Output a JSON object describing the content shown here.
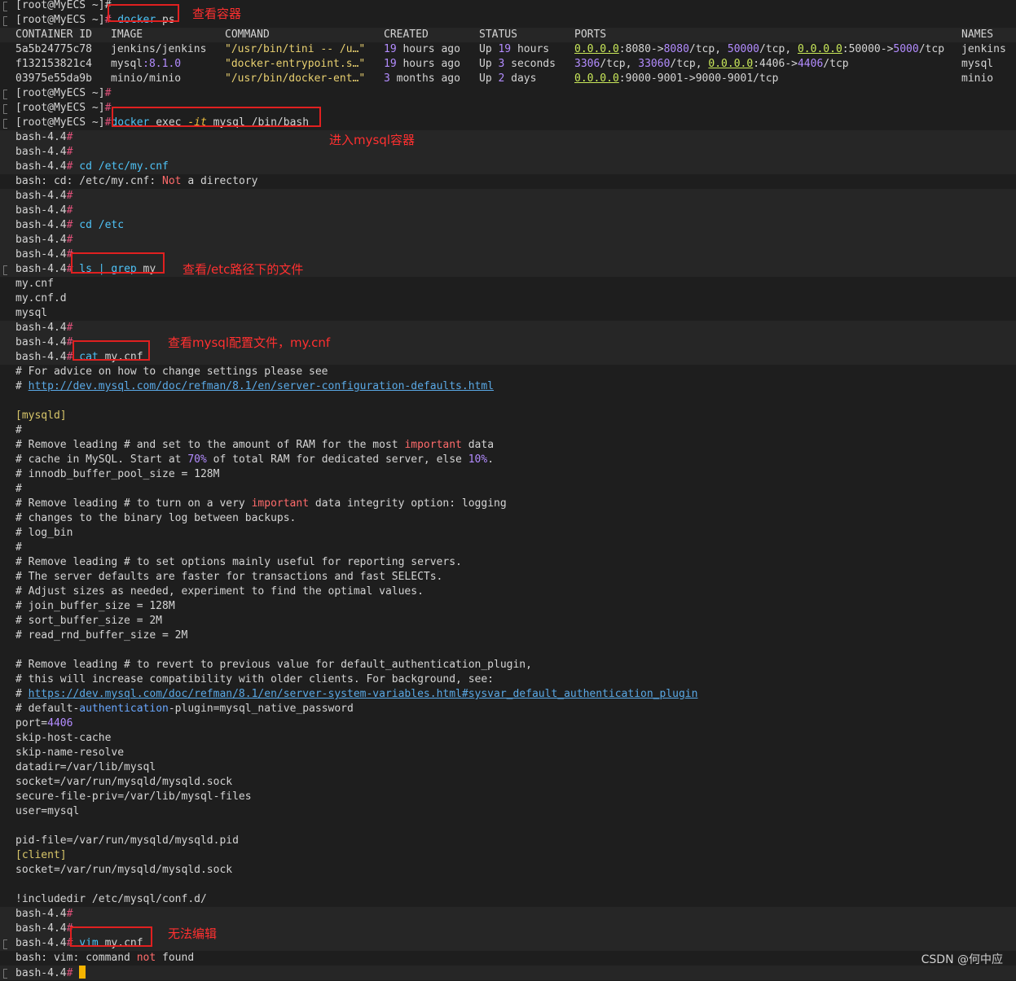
{
  "prompt_user": "[root@MyECS ~]",
  "bash_prompt": "bash-4.4",
  "hash": "#",
  "top_partial": "[root@MyECS ~]#",
  "cmd_docker_ps": {
    "cmd": "docker",
    "arg": "ps"
  },
  "docker_ps": {
    "headers": [
      "CONTAINER ID",
      "IMAGE",
      "COMMAND",
      "CREATED",
      "STATUS",
      "PORTS",
      "NAMES"
    ],
    "rows": [
      {
        "id": "5a5b24775c78",
        "image": "jenkins/jenkins",
        "image_tag": "",
        "command": "\"/usr/bin/tini -- /u…\"",
        "created_num": "19",
        "created_rest": " hours ago",
        "status_pre": "Up ",
        "status_num": "19",
        "status_rest": " hours",
        "ports": [
          [
            "g",
            "0.0.0.0"
          ],
          [
            "t",
            ":8080->"
          ],
          [
            "p",
            "8080"
          ],
          [
            "t",
            "/tcp, "
          ],
          [
            "p",
            "50000"
          ],
          [
            "t",
            "/tcp, "
          ],
          [
            "g",
            "0.0.0.0"
          ],
          [
            "t",
            ":50000->"
          ],
          [
            "p",
            "5000"
          ],
          [
            "t",
            "/tcp"
          ]
        ],
        "name": "jenkins"
      },
      {
        "id": "f132153821c4",
        "image": "mysql",
        "image_tag": ":8.1.0",
        "command": "\"docker-entrypoint.s…\"",
        "created_num": "19",
        "created_rest": " hours ago",
        "status_pre": "Up ",
        "status_num": "3",
        "status_rest": " seconds",
        "ports": [
          [
            "p",
            "3306"
          ],
          [
            "t",
            "/tcp, "
          ],
          [
            "p",
            "33060"
          ],
          [
            "t",
            "/tcp, "
          ],
          [
            "g",
            "0.0.0.0"
          ],
          [
            "t",
            ":4406->"
          ],
          [
            "p",
            "4406"
          ],
          [
            "t",
            "/tcp"
          ]
        ],
        "name": "mysql"
      },
      {
        "id": "03975e55da9b",
        "image": "minio/minio",
        "image_tag": "",
        "command": "\"/usr/bin/docker-ent…\"",
        "created_num": "3",
        "created_rest": " months ago",
        "status_pre": "Up ",
        "status_num": "2",
        "status_rest": " days",
        "ports": [
          [
            "g",
            "0.0.0.0"
          ],
          [
            "t",
            ":9000-9001->9000-9001/tcp"
          ]
        ],
        "name": "minio"
      }
    ]
  },
  "cmd_exec": {
    "cmd": "docker",
    "sub": "exec",
    "flag": "-it",
    "name": "mysql",
    "path": "/bin/bash"
  },
  "cmd_cd1": {
    "cmd": "cd",
    "arg": "/etc/my.cnf"
  },
  "err_cd": {
    "pre": "bash: cd: /etc/my.cnf: ",
    "not": "Not",
    "post": " a directory"
  },
  "cmd_cd2": {
    "cmd": "cd",
    "arg": "/etc"
  },
  "cmd_ls": {
    "cmd": "ls",
    "pipe": "|",
    "grep": "grep",
    "arg": "my"
  },
  "ls_output": [
    "my.cnf",
    "my.cnf.d",
    "mysql"
  ],
  "cmd_cat": {
    "cmd": "cat",
    "arg": "my.cnf"
  },
  "cnf": {
    "l1": "# For advice on how to change settings please see",
    "l2_hash": "# ",
    "l2_link": "http://dev.mysql.com/doc/refman/8.1/en/server-configuration-defaults.html",
    "section_mysqld": "[mysqld]",
    "hash_only": "#",
    "rl1_pre": "# Remove leading # and set to the amount of RAM for the most ",
    "important": "important",
    "rl1_post": " data",
    "rl2_pre": "# cache in MySQL. Start at ",
    "pct70": "70%",
    "rl2_mid": " of total RAM for dedicated server, else ",
    "pct10": "10%",
    "rl2_post": ".",
    "rl3": "# innodb_buffer_pool_size = 128M",
    "rl4_pre": "# Remove leading # to turn on a very ",
    "rl4_post": " data integrity option: logging",
    "rl5": "# changes to the binary log between backups.",
    "rl6": "# log_bin",
    "rl7": "# Remove leading # to set options mainly useful for reporting servers.",
    "rl8": "# The server defaults are faster for transactions and fast SELECTs.",
    "rl9": "# Adjust sizes as needed, experiment to find the optimal values.",
    "rl10": "# join_buffer_size = 128M",
    "rl11": "# sort_buffer_size = 2M",
    "rl12": "# read_rnd_buffer_size = 2M",
    "rl13": "# Remove leading # to revert to previous value for default_authentication_plugin,",
    "rl14": "# this will increase compatibility with older clients. For background, see:",
    "rl15_link": "https://dev.mysql.com/doc/refman/8.1/en/server-system-variables.html#sysvar_default_authentication_plugin",
    "rl16_pre": "# default-",
    "rl16_auth": "authentication",
    "rl16_post": "-plugin=mysql_native_password",
    "port_key": "port=",
    "port_val": "4406",
    "opt1": "skip-host-cache",
    "opt2": "skip-name-resolve",
    "opt3": "datadir=/var/lib/mysql",
    "opt4": "socket=/var/run/mysqld/mysqld.sock",
    "opt5": "secure-file-priv=/var/lib/mysql-files",
    "opt6": "user=mysql",
    "opt7": "pid-file=/var/run/mysqld/mysqld.pid",
    "section_client": "[client]",
    "opt8": "socket=/var/run/mysqld/mysqld.sock",
    "include": "!includedir /etc/mysql/conf.d/"
  },
  "cmd_vim": {
    "cmd": "vim",
    "arg": "my.cnf"
  },
  "err_vim": {
    "pre": "bash: vim: command ",
    "not": "not",
    "post": " found"
  },
  "annotations": {
    "a1": "查看容器",
    "a2": "进入mysql容器",
    "a3": "查看/etc路径下的文件",
    "a4": "查看mysql配置文件，my.cnf",
    "a5": "无法编辑"
  },
  "watermark": "CSDN @何中应",
  "colors": {
    "background": "#1e1e1e",
    "prompt_hash": "#e0517a",
    "command": "#4fc3f7",
    "annotation": "#ff3030"
  }
}
